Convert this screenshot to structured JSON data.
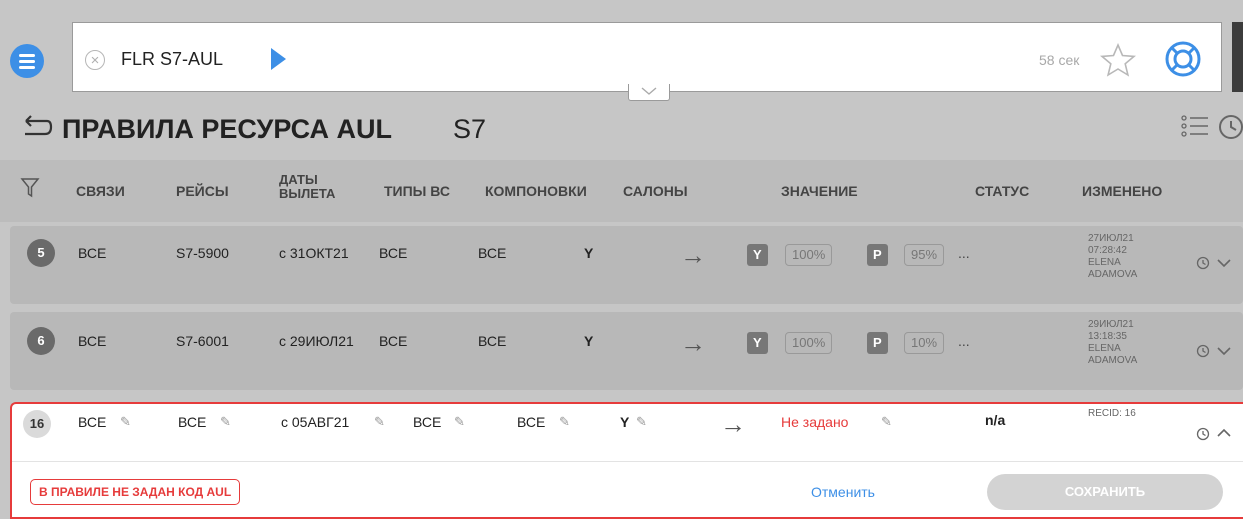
{
  "search": {
    "query": "FLR S7-AUL",
    "timer": "58 сек"
  },
  "page": {
    "title": "ПРАВИЛА РЕСУРСА AUL",
    "subtitle": "S7"
  },
  "columns": {
    "links": "СВЯЗИ",
    "flights": "РЕЙСЫ",
    "dates_line1": "ДАТЫ",
    "dates_line2": "ВЫЛЕТА",
    "aircraft": "ТИПЫ ВС",
    "configs": "КОМПОНОВКИ",
    "cabins": "САЛОНЫ",
    "value": "ЗНАЧЕНИЕ",
    "status": "СТАТУС",
    "changed": "ИЗМЕНЕНО"
  },
  "rows": [
    {
      "num": "5",
      "links": "ВСЕ",
      "flights": "S7-5900",
      "dates": "с 31ОКТ21",
      "aircraft": "ВСЕ",
      "configs": "ВСЕ",
      "cabins": "Y",
      "tag1": "Y",
      "pct1": "100%",
      "tag2": "P",
      "pct2": "95%",
      "more": "...",
      "changed_date": "27ИЮЛ21",
      "changed_time": "07:28:42",
      "changed_user1": "ELENA",
      "changed_user2": "ADAMOVA"
    },
    {
      "num": "6",
      "links": "ВСЕ",
      "flights": "S7-6001",
      "dates": "с 29ИЮЛ21",
      "aircraft": "ВСЕ",
      "configs": "ВСЕ",
      "cabins": "Y",
      "tag1": "Y",
      "pct1": "100%",
      "tag2": "P",
      "pct2": "10%",
      "more": "...",
      "changed_date": "29ИЮЛ21",
      "changed_time": "13:18:35",
      "changed_user1": "ELENA",
      "changed_user2": "ADAMOVA"
    }
  ],
  "edit_row": {
    "num": "16",
    "links": "ВСЕ",
    "flights": "ВСЕ",
    "dates": "с 05АВГ21",
    "aircraft": "ВСЕ",
    "configs": "ВСЕ",
    "cabins": "Y",
    "value": "Не задано",
    "status": "n/a",
    "recid": "RECID: 16",
    "error": "В ПРАВИЛЕ НЕ ЗАДАН КОД AUL",
    "cancel_label": "Отменить",
    "save_label": "СОХРАНИТЬ"
  },
  "colors": {
    "accent": "#3d8fe6",
    "error": "#e63b3b",
    "tag": "#777777"
  }
}
